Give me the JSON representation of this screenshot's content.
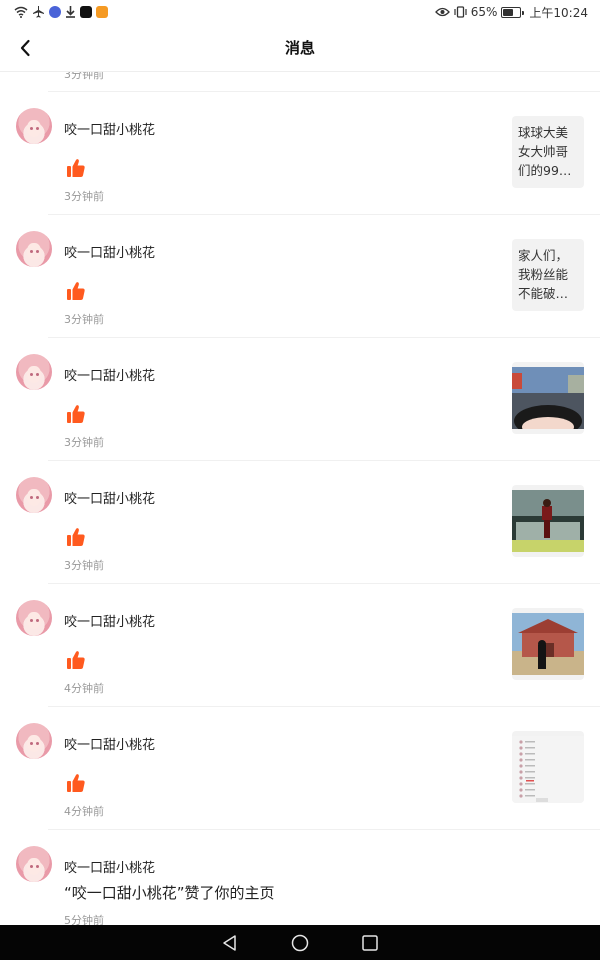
{
  "status_bar": {
    "battery": "65%",
    "battery_level": 0.65,
    "time": "上午10:24",
    "icons_left": [
      "wifi-icon",
      "airplane-icon",
      "browser-app-icon",
      "download-icon",
      "douyin-app-icon",
      "video-app-icon"
    ],
    "icons_right": [
      "eye-icon",
      "vibrate-icon",
      "battery-icon"
    ]
  },
  "header": {
    "title": "消息"
  },
  "prev_item": {
    "time": "3分钟前"
  },
  "notifications": [
    {
      "user": "咬一口甜小桃花",
      "action": "like",
      "time": "3分钟前",
      "preview_text": "球球大美女大帅哥们的99…"
    },
    {
      "user": "咬一口甜小桃花",
      "action": "like",
      "time": "3分钟前",
      "preview_text": "家人们，我粉丝能不能破…"
    },
    {
      "user": "咬一口甜小桃花",
      "action": "like",
      "time": "3分钟前",
      "preview_image": "game-screenshot-car"
    },
    {
      "user": "咬一口甜小桃花",
      "action": "like",
      "time": "3分钟前",
      "preview_image": "game-screenshot-stage"
    },
    {
      "user": "咬一口甜小桃花",
      "action": "like",
      "time": "4分钟前",
      "preview_image": "game-screenshot-building"
    },
    {
      "user": "咬一口甜小桃花",
      "action": "like",
      "time": "4分钟前",
      "preview_image": "message-list-screenshot"
    },
    {
      "user": "咬一口甜小桃花",
      "action": "follow",
      "message": "“咬一口甜小桃花”赞了你的主页",
      "time": "5分钟前"
    }
  ],
  "colors": {
    "accent": "#ff5a1f",
    "divider": "#f0f0f0",
    "muted_text": "#999999",
    "nav_bg": "#050505"
  }
}
